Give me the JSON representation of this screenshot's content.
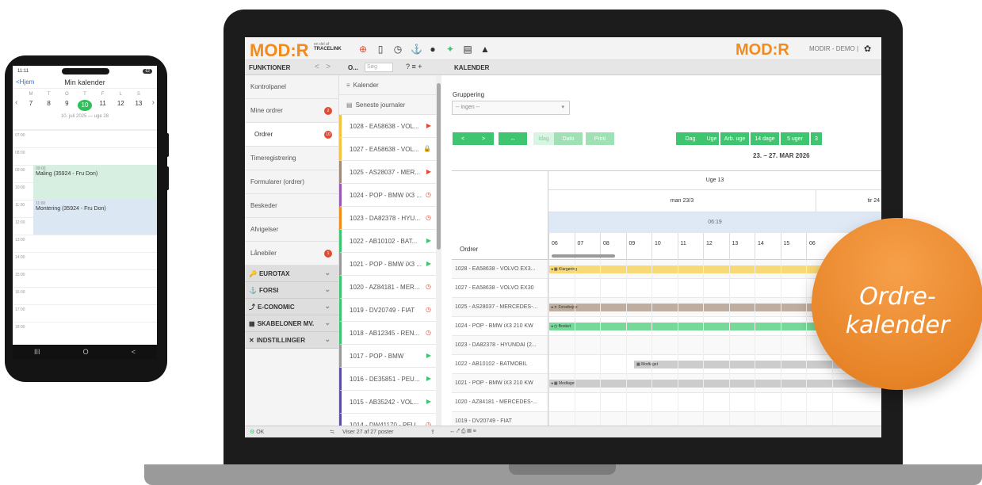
{
  "phone": {
    "time": "11:11",
    "battery": "62",
    "back": "Hjem",
    "title": "Min kalender",
    "weekday_letters": [
      "M",
      "T",
      "O",
      "T",
      "F",
      "L",
      "S"
    ],
    "day_numbers": [
      "7",
      "8",
      "9",
      "10",
      "11",
      "12",
      "13"
    ],
    "selected_day": "10",
    "week_subtitle": "10. juli 2025 — uge 28",
    "hours": [
      "07:00",
      "08:00",
      "09:00",
      "10:00",
      "11:00",
      "12:00",
      "13:00",
      "14:00",
      "15:00",
      "16:00",
      "17:00",
      "18:00"
    ],
    "events": [
      {
        "time": "09:00",
        "title": "Maling (35924 - Fru Don)",
        "color": "#d7efe0"
      },
      {
        "time": "11:00",
        "title": "Montering (35924 - Fru Don)",
        "color": "#dbe8f4"
      }
    ],
    "nav_buttons": [
      "III",
      "O",
      "<"
    ]
  },
  "app": {
    "logo": "MOD:R",
    "logo_sub_1": "en del af",
    "logo_sub_2": "TRACELINK",
    "toolbar_icons": [
      "lifebuoy-icon",
      "phone-icon",
      "clock-alert-icon",
      "anchor-icon",
      "chat-icon",
      "sync-icon",
      "keyboard-icon",
      "warning-icon"
    ],
    "toolbar_glyphs": [
      "⊕",
      "▯",
      "◷",
      "⚓",
      "●",
      "✦",
      "▤",
      "▲"
    ],
    "user_label": "MODIR - DEMO  |",
    "funktioner": "FUNKTIONER",
    "nav_back": "<",
    "nav_fwd": ">",
    "o_label": "O...",
    "search_placeholder": "Søg",
    "tools": "?  ≡  +",
    "kalender_header": "KALENDER"
  },
  "sidebar": {
    "items": [
      {
        "label": "Kontrolpanel",
        "badge": ""
      },
      {
        "label": "Mine ordrer",
        "badge": "2"
      },
      {
        "label": "Ordrer",
        "badge": "10"
      },
      {
        "label": "Timeregistrering",
        "badge": ""
      },
      {
        "label": "Formularer (ordrer)",
        "badge": ""
      },
      {
        "label": "Beskeder",
        "badge": ""
      },
      {
        "label": "Afvigelser",
        "badge": ""
      },
      {
        "label": "Lånebiler",
        "badge": "1"
      }
    ],
    "groups": [
      {
        "label": "EUROTAX",
        "icon": "🔑"
      },
      {
        "label": "FORSI",
        "icon": "⚓"
      },
      {
        "label": "E-CONOMIC",
        "icon": "⤴"
      },
      {
        "label": "SKABELONER MV.",
        "icon": "▦"
      },
      {
        "label": "INDSTILLINGER",
        "icon": "✕"
      }
    ],
    "status": "OK"
  },
  "midlist": {
    "tabs": [
      {
        "label": "Kalender",
        "icon": "≡"
      },
      {
        "label": "Seneste journaler",
        "icon": "▤"
      }
    ],
    "rows": [
      {
        "label": "1028 - EA58638 - VOL...",
        "color": "#f5c342",
        "status": "▶",
        "status_color": "#e24b32"
      },
      {
        "label": "1027 - EA58638 - VOL...",
        "color": "#f5c342",
        "status": "🔒",
        "status_color": "#999999"
      },
      {
        "label": "1025 - AS28037 - MER...",
        "color": "#a08a7a",
        "status": "▶",
        "status_color": "#e24b32"
      },
      {
        "label": "1024 - POP - BMW iX3 ...",
        "color": "#9b59b6",
        "status": "◷",
        "status_color": "#e24b32"
      },
      {
        "label": "1023 - DA82378 - HYU...",
        "color": "#f28b1e",
        "status": "◷",
        "status_color": "#e24b32"
      },
      {
        "label": "1022 - AB10102 - BAT...",
        "color": "#3fc56f",
        "status": "▶",
        "status_color": "#3fc56f"
      },
      {
        "label": "1021 - POP - BMW iX3 ...",
        "color": "#999999",
        "status": "▶",
        "status_color": "#3fc56f"
      },
      {
        "label": "1020 - AZ84181 - MER...",
        "color": "#3fc56f",
        "status": "◷",
        "status_color": "#e24b32"
      },
      {
        "label": "1019 - DV20749 - FIAT",
        "color": "#3fc56f",
        "status": "◷",
        "status_color": "#e24b32"
      },
      {
        "label": "1018 - AB12345 - REN...",
        "color": "#3fc56f",
        "status": "◷",
        "status_color": "#e24b32"
      },
      {
        "label": "1017 - POP - BMW",
        "color": "#999999",
        "status": "▶",
        "status_color": "#3fc56f"
      },
      {
        "label": "1016 - DE35851 - PEU...",
        "color": "#5b4fa3",
        "status": "▶",
        "status_color": "#3fc56f"
      },
      {
        "label": "1015 - AB35242 - VOL...",
        "color": "#5b4fa3",
        "status": "▶",
        "status_color": "#3fc56f"
      },
      {
        "label": "1014 - DW41170 - PEU...",
        "color": "#5b4fa3",
        "status": "◷",
        "status_color": "#e24b32"
      }
    ],
    "footer": "Viser 27 af 27 poster"
  },
  "main": {
    "grouping_label": "Gruppering",
    "grouping_value": "-- ingen --",
    "buttons": [
      {
        "label": "<",
        "style": "green"
      },
      {
        "label": ">",
        "style": "green"
      },
      {
        "label": "↔",
        "style": "green"
      },
      {
        "label": "Idag",
        "style": "light"
      },
      {
        "label": "Dato",
        "style": "mid"
      },
      {
        "label": "Print",
        "style": "mid"
      },
      {
        "label": "Dag",
        "style": "green"
      },
      {
        "label": "Uge",
        "style": "green"
      },
      {
        "label": "Arb. uge",
        "style": "green"
      },
      {
        "label": "14 dage",
        "style": "green"
      },
      {
        "label": "5 uger",
        "style": "green"
      },
      {
        "label": "3",
        "style": "green"
      }
    ],
    "date_range": "23. – 27. MAR 2026",
    "orders_header": "Ordrer",
    "week_label": "Uge 13",
    "day1": "man 23/3",
    "day2": "tir 24",
    "now_time": "06:19",
    "hours": [
      "06",
      "07",
      "08",
      "09",
      "10",
      "11",
      "12",
      "13",
      "14",
      "15",
      "06"
    ],
    "rows": [
      "1028 - EA58638 - VOLVO EX3...",
      "1027 - EA58638 - VOLVO EX30",
      "1025 - AS28037 - MERCEDES-...",
      "1024 - POP - BMW iX3 210 KW",
      "1023 - DA82378 - HYUNDAI (2...",
      "1022 - AB10102 - BATMOBIL",
      "1021 - POP - BMW iX3 210 KW",
      "1020 - AZ84181 - MERCEDES-...",
      "1019 - DV20749 - FIAT"
    ],
    "bars": [
      {
        "row": 0,
        "label": "◂ ▦ Klargøring",
        "color": "#f7d978"
      },
      {
        "row": 2,
        "label": "◂ ✕ Forarbejde",
        "color": "#bfae9f"
      },
      {
        "row": 3,
        "label": "◂ ◷ Booket",
        "color": "#76d99a"
      },
      {
        "row": 5,
        "label": "▦ Modtaget",
        "color": "#cccccc"
      },
      {
        "row": 6,
        "label": "◂ ▦ Modtaget",
        "color": "#cccccc"
      }
    ],
    "footer_icons": "↔  ⤤  ⎙  ▤  ≡"
  },
  "bubble": {
    "line1": "Ordre-",
    "line2": "kalender"
  }
}
